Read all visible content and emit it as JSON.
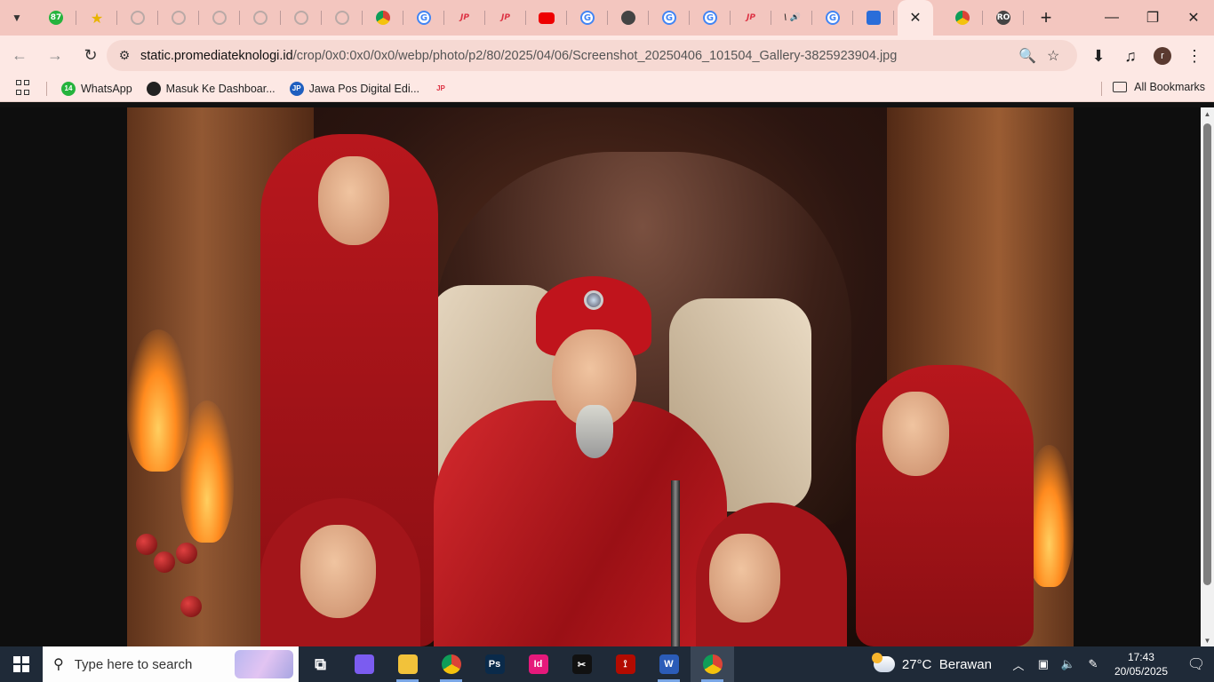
{
  "browser": {
    "tabs": [
      {
        "icon": "whatsapp-icon",
        "badge": "87"
      },
      {
        "icon": "star-icon"
      },
      {
        "icon": "blank-icon"
      },
      {
        "icon": "blank-icon"
      },
      {
        "icon": "blank-icon"
      },
      {
        "icon": "blank-icon"
      },
      {
        "icon": "blank-icon"
      },
      {
        "icon": "blank-icon"
      },
      {
        "icon": "chrome-icon"
      },
      {
        "icon": "google-icon",
        "glyph": "G"
      },
      {
        "icon": "jp-icon",
        "glyph": "JP"
      },
      {
        "icon": "jp-icon",
        "glyph": "JP"
      },
      {
        "icon": "youtube-icon"
      },
      {
        "icon": "google-icon",
        "glyph": "G"
      },
      {
        "icon": "dark-icon"
      },
      {
        "icon": "google-icon",
        "glyph": "G"
      },
      {
        "icon": "google-icon",
        "glyph": "G"
      },
      {
        "icon": "jp-icon",
        "glyph": "JP"
      },
      {
        "icon": "audio-icon",
        "glyph": "\\ 🔊"
      },
      {
        "icon": "google-icon",
        "glyph": "G"
      },
      {
        "icon": "blue-icon"
      }
    ],
    "active_tab_close": "✕",
    "after_tabs": [
      {
        "icon": "chrome-icon"
      },
      {
        "icon": "ro-icon",
        "glyph": "RO"
      }
    ],
    "new_tab": "+",
    "window_controls": {
      "minimize": "—",
      "maximize": "❐",
      "close": "✕"
    }
  },
  "toolbar": {
    "back": "←",
    "forward": "→",
    "reload": "↻",
    "site_info": "⚙",
    "url_host": "static.promediateknologi.id",
    "url_path": "/crop/0x0:0x0/0x0/webp/photo/p2/80/2025/04/06/Screenshot_20250406_101504_Gallery-3825923904.jpg",
    "zoom": "🔍",
    "bookmark_star": "☆",
    "download": "⬇",
    "media": "♫",
    "profile_letter": "r",
    "menu": "⋮"
  },
  "bookmarks": {
    "items": [
      {
        "label": "WhatsApp",
        "icon_color": "#25b33d",
        "icon_text": "14"
      },
      {
        "label": "Masuk Ke Dashboar...",
        "icon_color": "#222",
        "icon_text": ""
      },
      {
        "label": "Jawa Pos Digital Edi...",
        "icon_color": "#1f5fbf",
        "icon_text": "JP"
      },
      {
        "label": "",
        "icon_color": "#d34",
        "icon_text": "JP"
      }
    ],
    "all_bookmarks": "All Bookmarks"
  },
  "taskbar": {
    "search_placeholder": "Type here to search",
    "apps": [
      {
        "name": "task-view-icon",
        "glyph": "⧉",
        "color": "transparent"
      },
      {
        "name": "copilot-icon",
        "glyph": "",
        "color": "#7b5cf0"
      },
      {
        "name": "file-explorer-icon",
        "glyph": "",
        "color": "#f2c23a"
      },
      {
        "name": "chrome-icon",
        "glyph": "",
        "color": "chrome"
      },
      {
        "name": "photoshop-icon",
        "glyph": "Ps",
        "color": "#0a2a4a"
      },
      {
        "name": "indesign-icon",
        "glyph": "Id",
        "color": "#e5197b"
      },
      {
        "name": "capcut-icon",
        "glyph": "✂",
        "color": "#111"
      },
      {
        "name": "acrobat-icon",
        "glyph": "⟟",
        "color": "#b30b00"
      },
      {
        "name": "word-icon",
        "glyph": "W",
        "color": "#2b5cb8"
      },
      {
        "name": "chrome-profile-icon",
        "glyph": "",
        "color": "chrome"
      }
    ],
    "weather_temp": "27°C",
    "weather_text": "Berawan",
    "time": "17:43",
    "date": "20/05/2025"
  }
}
